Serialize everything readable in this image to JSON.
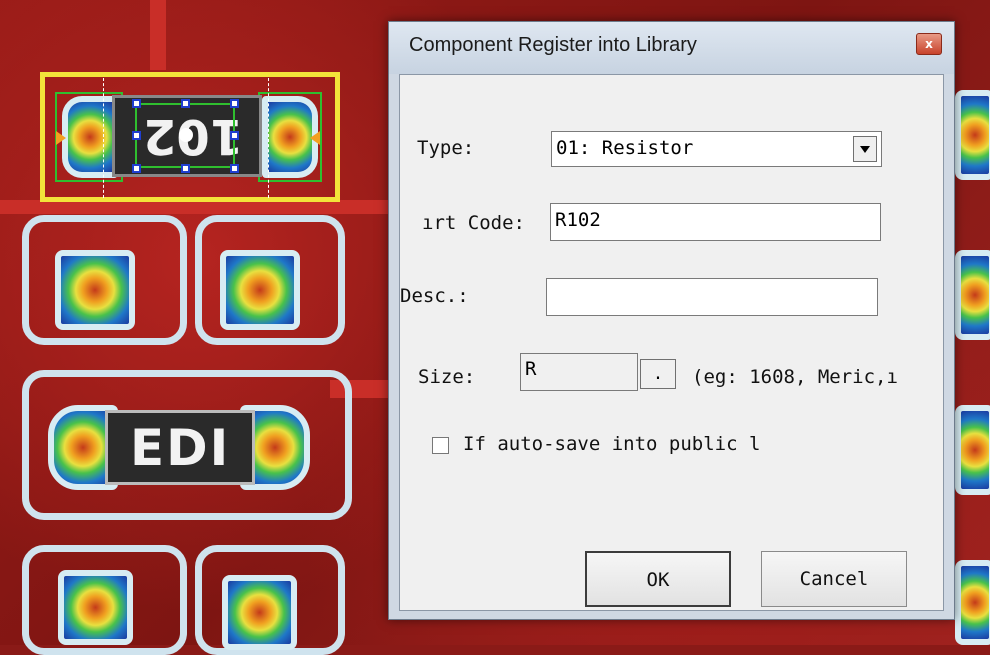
{
  "dialog": {
    "title": "Component Register into Library",
    "close_glyph": "x",
    "type_label": "Type:",
    "type_value": "01: Resistor",
    "part_code_label": "ırt Code:",
    "part_code_value": "R102",
    "desc_label": "Desc.:",
    "desc_value": "",
    "size_label": "Size:",
    "size_value": "R",
    "size_browse": ".",
    "size_hint": "(eg: 1608, Meric,ı",
    "autosave_label": "If auto-save into public l",
    "ok_label": "OK",
    "cancel_label": "Cancel"
  },
  "board": {
    "chip_top_label": "102",
    "chip_bottom_label": "EDI"
  },
  "colors": {
    "selection": "#f3e33a",
    "handle": "#1f3fd0",
    "board": "#8a1a17",
    "silkscreen": "#cfe3ee"
  }
}
